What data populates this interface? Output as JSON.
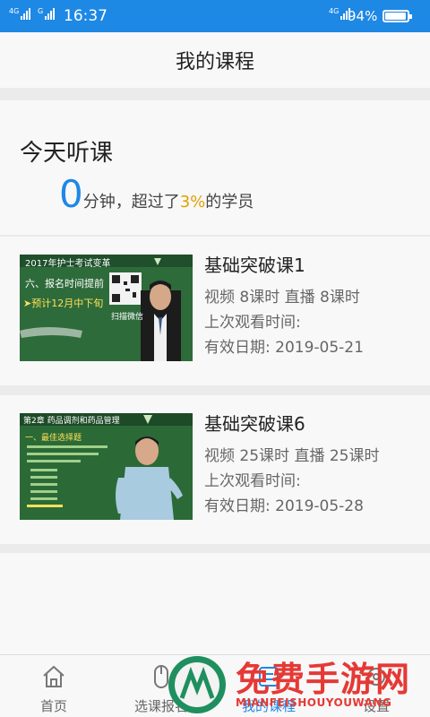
{
  "status_bar": {
    "network_left": "4G",
    "network_left_2": "G",
    "time": "16:37",
    "network_right": "4G",
    "battery_percent": "94%",
    "battery_level": 0.94
  },
  "header": {
    "title": "我的课程"
  },
  "today": {
    "heading": "今天听课",
    "minutes": "0",
    "text_before": "分钟，超过了",
    "percent": "3%",
    "text_after": "的学员"
  },
  "courses": [
    {
      "name": "基础突破课1",
      "hours": "视频 8课时  直播 8课时",
      "last_watched": "上次观看时间:",
      "valid_until": "有效日期: 2019-05-21",
      "thumb": {
        "headline": "2017年护士考试变革",
        "item": "六、报名时间提前",
        "bullet": "➤预计12月中下旬",
        "caption": "扫描微信",
        "bg": "#2f6f3c"
      }
    },
    {
      "name": "基础突破课6",
      "hours": "视频 25课时  直播 25课时",
      "last_watched": "上次观看时间:",
      "valid_until": "有效日期: 2019-05-28",
      "thumb": {
        "headline": "第2章  药品调剂和药品管理",
        "item": "一、最佳选择题",
        "bg": "#2f6f3c"
      }
    }
  ],
  "tabs": [
    {
      "label": "首页",
      "icon": "home-icon",
      "active": false
    },
    {
      "label": "选课报名",
      "icon": "mouse-icon",
      "active": false
    },
    {
      "label": "我的课程",
      "icon": "course-icon",
      "active": true
    },
    {
      "label": "设置",
      "icon": "gear-icon",
      "active": false
    }
  ],
  "watermark": {
    "text_cn": "免费手游网",
    "text_en": "MIANFEISHOUYOUWANG"
  },
  "colors": {
    "primary": "#1e88e5",
    "highlight": "#e0a100",
    "watermark": "#e53935"
  }
}
